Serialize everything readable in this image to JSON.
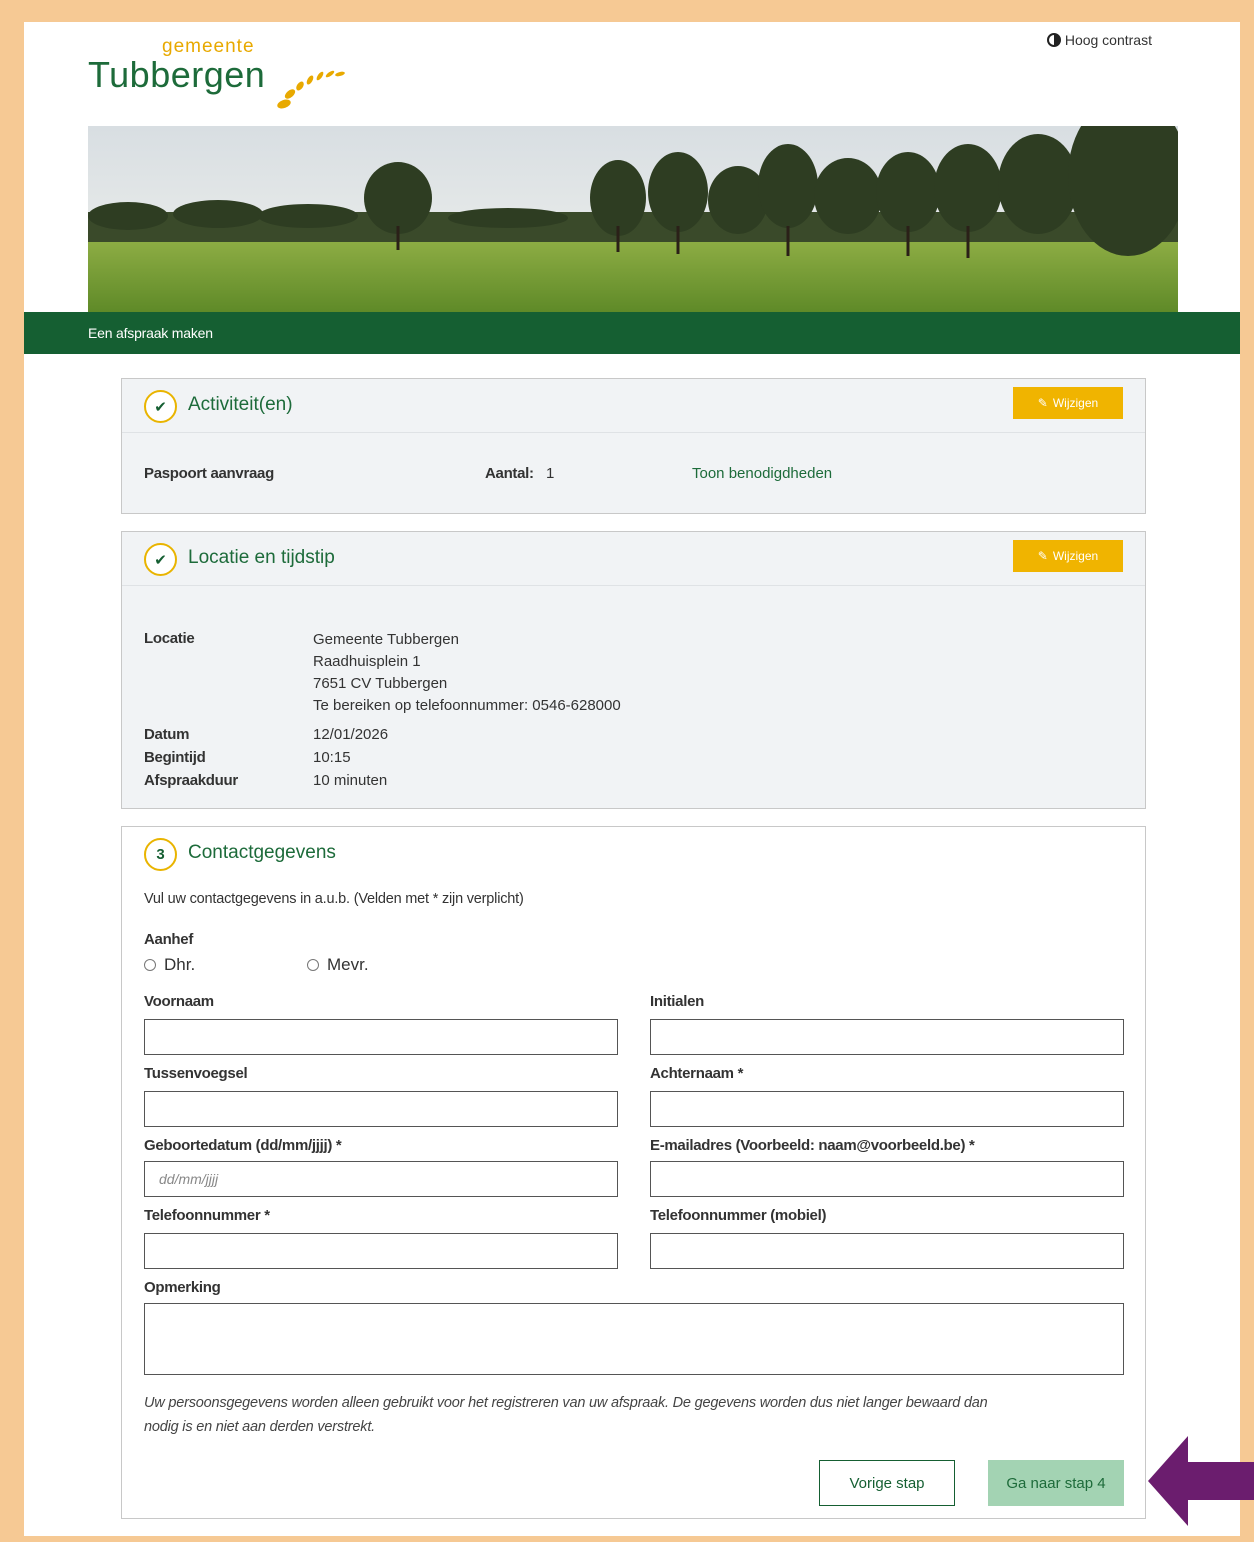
{
  "header": {
    "logo_top": "gemeente",
    "logo_main": "Tubbergen",
    "contrast_label": "Hoog contrast"
  },
  "nav": {
    "title": "Een afspraak maken"
  },
  "step1": {
    "number": "✔",
    "title": "Activiteit(en)",
    "edit_label": "Wijzigen",
    "activity": "Paspoort aanvraag",
    "count_label": "Aantal:",
    "count_value": "1",
    "requirements_link": "Toon benodigdheden"
  },
  "step2": {
    "number": "✔",
    "title": "Locatie en tijdstip",
    "edit_label": "Wijzigen",
    "location_label": "Locatie",
    "location_lines": [
      "Gemeente Tubbergen",
      "Raadhuisplein 1",
      "7651 CV Tubbergen",
      "Te bereiken op telefoonnummer: 0546-628000"
    ],
    "date_label": "Datum",
    "date_value": "12/01/2026",
    "start_label": "Begintijd",
    "start_value": "10:15",
    "duration_label": "Afspraakduur",
    "duration_value": "10 minuten"
  },
  "step3": {
    "number": "3",
    "title": "Contactgegevens",
    "intro": "Vul uw contactgegevens in a.u.b. (Velden met * zijn verplicht)",
    "salutation_label": "Aanhef",
    "salutation_options": [
      "Dhr.",
      "Mevr."
    ],
    "fields": {
      "voornaam": "Voornaam",
      "initialen": "Initialen",
      "tussenvoegsel": "Tussenvoegsel",
      "achternaam": "Achternaam *",
      "geboortedatum": "Geboortedatum (dd/mm/jjjj) *",
      "geboortedatum_placeholder": "dd/mm/jjjj",
      "email": "E-mailadres (Voorbeeld: naam@voorbeeld.be) *",
      "telefoon": "Telefoonnummer *",
      "mobiel": "Telefoonnummer (mobiel)",
      "opmerking": "Opmerking"
    },
    "privacy_note_1": "Uw persoonsgegevens worden alleen gebruikt voor het registreren van uw afspraak. De gegevens worden dus niet langer bewaard dan",
    "privacy_note_2": "nodig is en niet aan derden verstrekt.",
    "prev_label": "Vorige stap",
    "next_label": "Ga naar stap 4"
  },
  "colors": {
    "brand_green": "#155f32",
    "accent_yellow": "#f0b400",
    "frame_orange": "#f6c994",
    "arrow_purple": "#6b1d6e"
  }
}
